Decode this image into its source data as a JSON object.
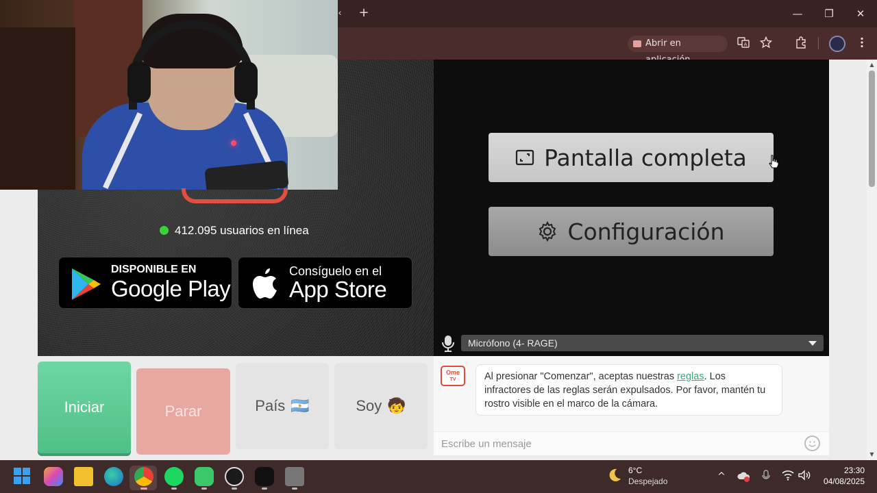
{
  "browser": {
    "open_in_app": "Abrir en aplicación",
    "tab_back": "‹",
    "new_tab": "+",
    "minimize": "—",
    "restore": "❐",
    "close": "✕"
  },
  "page": {
    "online_count_text": "412.095 usuarios en línea",
    "google_play": {
      "small": "DISPONIBLE EN",
      "big": "Google Play"
    },
    "app_store": {
      "small": "Consíguelo en el",
      "big": "App Store"
    },
    "fullscreen_label": "Pantalla completa",
    "settings_label": "Configuración",
    "microphone_select": "Micrófono (4- RAGE)",
    "controls": {
      "start": "Iniciar",
      "stop": "Parar",
      "country": "País",
      "country_flag": "🇦🇷",
      "soy": "Soy",
      "soy_emoji": "🧒"
    },
    "chat": {
      "logo_top": "Ome",
      "logo_bottom": "TV",
      "message_before_link": "Al presionar \"Comenzar\", aceptas nuestras ",
      "message_link": "reglas",
      "message_after_link": ". Los infractores de las reglas serán expulsados. Por favor, mantén tu rostro visible en el marco de la cámara.",
      "input_placeholder": "Escribe un mensaje"
    }
  },
  "taskbar": {
    "weather_temp": "6°C",
    "weather_desc": "Despejado",
    "time": "23:30",
    "date": "04/08/2025",
    "apps": [
      "windows-start",
      "copilot",
      "file-explorer",
      "edge",
      "chrome",
      "spotify",
      "discord",
      "obs",
      "tiktok",
      "app"
    ]
  },
  "colors": {
    "start_button": "#5ccc94",
    "stop_button": "#e8a8a2",
    "online_dot": "#3ad13a",
    "link": "#3aa67a"
  }
}
